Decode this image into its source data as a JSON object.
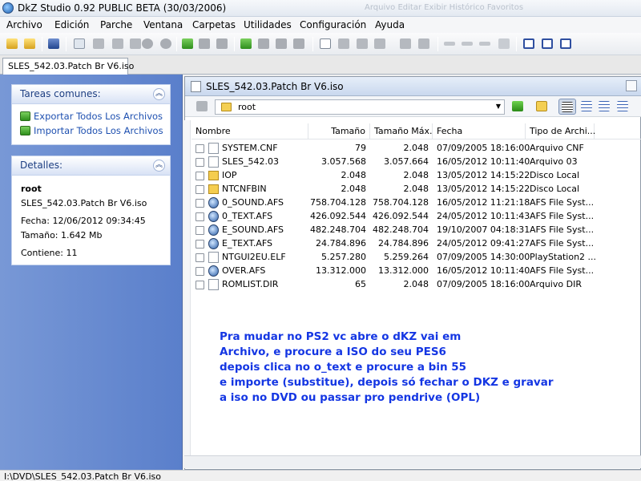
{
  "window": {
    "title": "DkZ Studio 0.92 PUBLIC BETA (30/03/2006)",
    "ghost_text": "Arquivo  Editar  Exibir  Histórico  Favoritos"
  },
  "menu": [
    "Archivo",
    "Edición",
    "Parche",
    "Ventana",
    "Carpetas",
    "Utilidades",
    "Configuración",
    "Ayuda"
  ],
  "doc_tab": "SLES_542.03.Patch Br V6.iso",
  "left_panel": {
    "tasks_title": "Tareas comunes:",
    "tasks": [
      "Exportar Todos Los Archivos",
      "Importar Todos Los Archivos"
    ],
    "details_title": "Detalles:",
    "details": {
      "name": "root",
      "file": "SLES_542.03.Patch Br V6.iso",
      "date": "Fecha: 12/06/2012 09:34:45",
      "size": "Tamaño: 1.642 Mb",
      "contains": "Contiene: 11"
    }
  },
  "explorer": {
    "title": "SLES_542.03.Patch Br V6.iso",
    "path": "root",
    "columns": [
      "Nombre",
      "Tamaño",
      "Tamaño Máx.",
      "Fecha",
      "Tipo de Archi..."
    ],
    "files": [
      {
        "name": "SYSTEM.CNF",
        "size": "79",
        "max": "2.048",
        "date": "07/09/2005 18:16:00",
        "type": "Arquivo CNF",
        "icon": "file"
      },
      {
        "name": "SLES_542.03",
        "size": "3.057.568",
        "max": "3.057.664",
        "date": "16/05/2012 10:11:40",
        "type": "Arquivo 03",
        "icon": "file"
      },
      {
        "name": "IOP",
        "size": "2.048",
        "max": "2.048",
        "date": "13/05/2012 14:15:22",
        "type": "Disco Local",
        "icon": "folder"
      },
      {
        "name": "NTCNFBIN",
        "size": "2.048",
        "max": "2.048",
        "date": "13/05/2012 14:15:22",
        "type": "Disco Local",
        "icon": "folder"
      },
      {
        "name": "0_SOUND.AFS",
        "size": "758.704.128",
        "max": "758.704.128",
        "date": "16/05/2012 11:21:18",
        "type": "AFS File Syst...",
        "icon": "afs"
      },
      {
        "name": "0_TEXT.AFS",
        "size": "426.092.544",
        "max": "426.092.544",
        "date": "24/05/2012 10:11:43",
        "type": "AFS File Syst...",
        "icon": "afs"
      },
      {
        "name": "E_SOUND.AFS",
        "size": "482.248.704",
        "max": "482.248.704",
        "date": "19/10/2007 04:18:31",
        "type": "AFS File Syst...",
        "icon": "afs"
      },
      {
        "name": "E_TEXT.AFS",
        "size": "24.784.896",
        "max": "24.784.896",
        "date": "24/05/2012 09:41:27",
        "type": "AFS File Syst...",
        "icon": "afs"
      },
      {
        "name": "NTGUI2EU.ELF",
        "size": "5.257.280",
        "max": "5.259.264",
        "date": "07/09/2005 14:30:00",
        "type": "PlayStation2 ...",
        "icon": "file"
      },
      {
        "name": "OVER.AFS",
        "size": "13.312.000",
        "max": "13.312.000",
        "date": "16/05/2012 10:11:40",
        "type": "AFS File Syst...",
        "icon": "afs"
      },
      {
        "name": "ROMLIST.DIR",
        "size": "65",
        "max": "2.048",
        "date": "07/09/2005 18:16:00",
        "type": "Arquivo DIR",
        "icon": "file"
      }
    ]
  },
  "note": [
    "Pra mudar no PS2 vc abre o dKZ vai em",
    "Archivo, e procure a ISO do seu PES6",
    "depois clica no o_text e procure a bin 55",
    "e importe (substitue), depois só fechar o DKZ e gravar",
    "a iso no DVD ou passar pro pendrive (OPL)"
  ],
  "status": "I:\\DVD\\SLES_542.03.Patch Br V6.iso",
  "colors": {
    "accent": "#1436e3",
    "panel": "#6a8bd1",
    "link": "#1e50b0"
  }
}
